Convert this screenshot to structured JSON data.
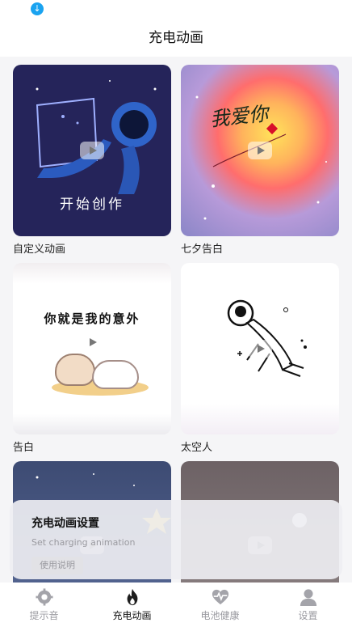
{
  "status_bar": {
    "icon": "download-icon"
  },
  "header": {
    "title": "充电动画"
  },
  "cards": [
    {
      "label": "自定义动画",
      "overlay_text": "开始创作"
    },
    {
      "label": "七夕告白",
      "overlay_text": "我爱你"
    },
    {
      "label": "告白",
      "overlay_text": "你就是我的意外"
    },
    {
      "label": "太空人"
    },
    {
      "label": ""
    },
    {
      "label": ""
    }
  ],
  "overlay": {
    "title": "充电动画设置",
    "subtitle": "Set charging animation",
    "button": "使用说明"
  },
  "tabbar": {
    "items": [
      {
        "label": "提示音",
        "icon": "gear-icon",
        "active": false
      },
      {
        "label": "充电动画",
        "icon": "flame-icon",
        "active": true
      },
      {
        "label": "电池健康",
        "icon": "heartbeat-icon",
        "active": false
      },
      {
        "label": "设置",
        "icon": "user-icon",
        "active": false
      }
    ]
  },
  "colors": {
    "accent_blue": "#1aa3f0",
    "active_tab": "#111111",
    "inactive_tab": "#9a9aa0"
  }
}
